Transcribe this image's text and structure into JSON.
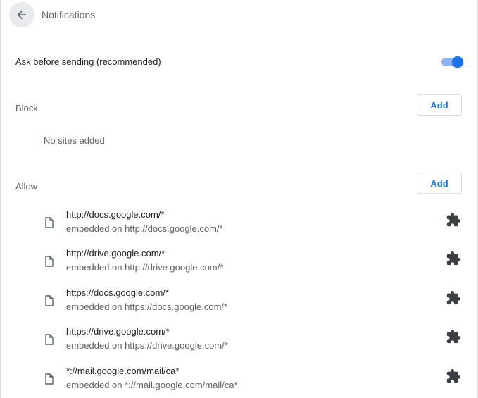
{
  "header": {
    "back_icon": "arrow-left-icon",
    "title": "Notifications"
  },
  "ask": {
    "label": "Ask before sending (recommended)",
    "toggle_on": true,
    "accent": "#1a73e8"
  },
  "block": {
    "label": "Block",
    "add_label": "Add",
    "empty_text": "No sites added"
  },
  "allow": {
    "label": "Allow",
    "add_label": "Add",
    "sites": [
      {
        "url": "http://docs.google.com/*",
        "embedded": "embedded on http://docs.google.com/*",
        "icon": "file-icon",
        "action_icon": "extension-puzzle-icon"
      },
      {
        "url": "http://drive.google.com/*",
        "embedded": "embedded on http://drive.google.com/*",
        "icon": "file-icon",
        "action_icon": "extension-puzzle-icon"
      },
      {
        "url": "https://docs.google.com/*",
        "embedded": "embedded on https://docs.google.com/*",
        "icon": "file-icon",
        "action_icon": "extension-puzzle-icon"
      },
      {
        "url": "https://drive.google.com/*",
        "embedded": "embedded on https://drive.google.com/*",
        "icon": "file-icon",
        "action_icon": "extension-puzzle-icon"
      },
      {
        "url": "*://mail.google.com/mail/ca*",
        "embedded": "embedded on *://mail.google.com/mail/ca*",
        "icon": "file-icon",
        "action_icon": "extension-puzzle-icon"
      }
    ]
  }
}
